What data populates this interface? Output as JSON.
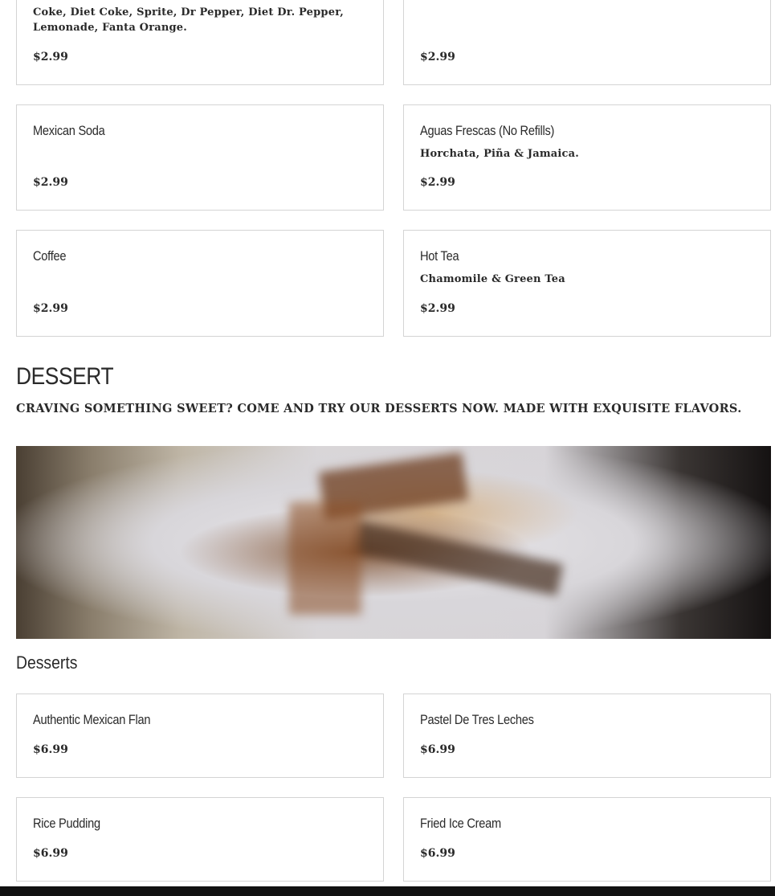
{
  "drinks": [
    {
      "name": "",
      "desc": "Coke, Diet Coke, Sprite, Dr Pepper, Diet Dr. Pepper, Lemonade, Fanta Orange.",
      "price": "$2.99"
    },
    {
      "name": "",
      "desc": "",
      "price": "$2.99"
    },
    {
      "name": "Mexican Soda",
      "desc": "",
      "price": "$2.99"
    },
    {
      "name": "Aguas Frescas (No Refills)",
      "desc": "Horchata, Piña & Jamaica.",
      "price": "$2.99"
    },
    {
      "name": "Coffee",
      "desc": "",
      "price": "$2.99"
    },
    {
      "name": "Hot Tea",
      "desc": "Chamomile & Green Tea",
      "price": "$2.99"
    }
  ],
  "dessert_section": {
    "title": "DESSERT",
    "description": "CRAVING SOMETHING SWEET? COME AND TRY OUR DESSERTS NOW. MADE WITH EXQUISITE FLAVORS.",
    "subcategory": "Desserts"
  },
  "desserts": [
    {
      "name": "Authentic Mexican Flan",
      "price": "$6.99"
    },
    {
      "name": "Pastel De Tres Leches",
      "price": "$6.99"
    },
    {
      "name": "Rice Pudding",
      "price": "$6.99"
    },
    {
      "name": "Fried Ice Cream",
      "price": "$6.99"
    }
  ]
}
